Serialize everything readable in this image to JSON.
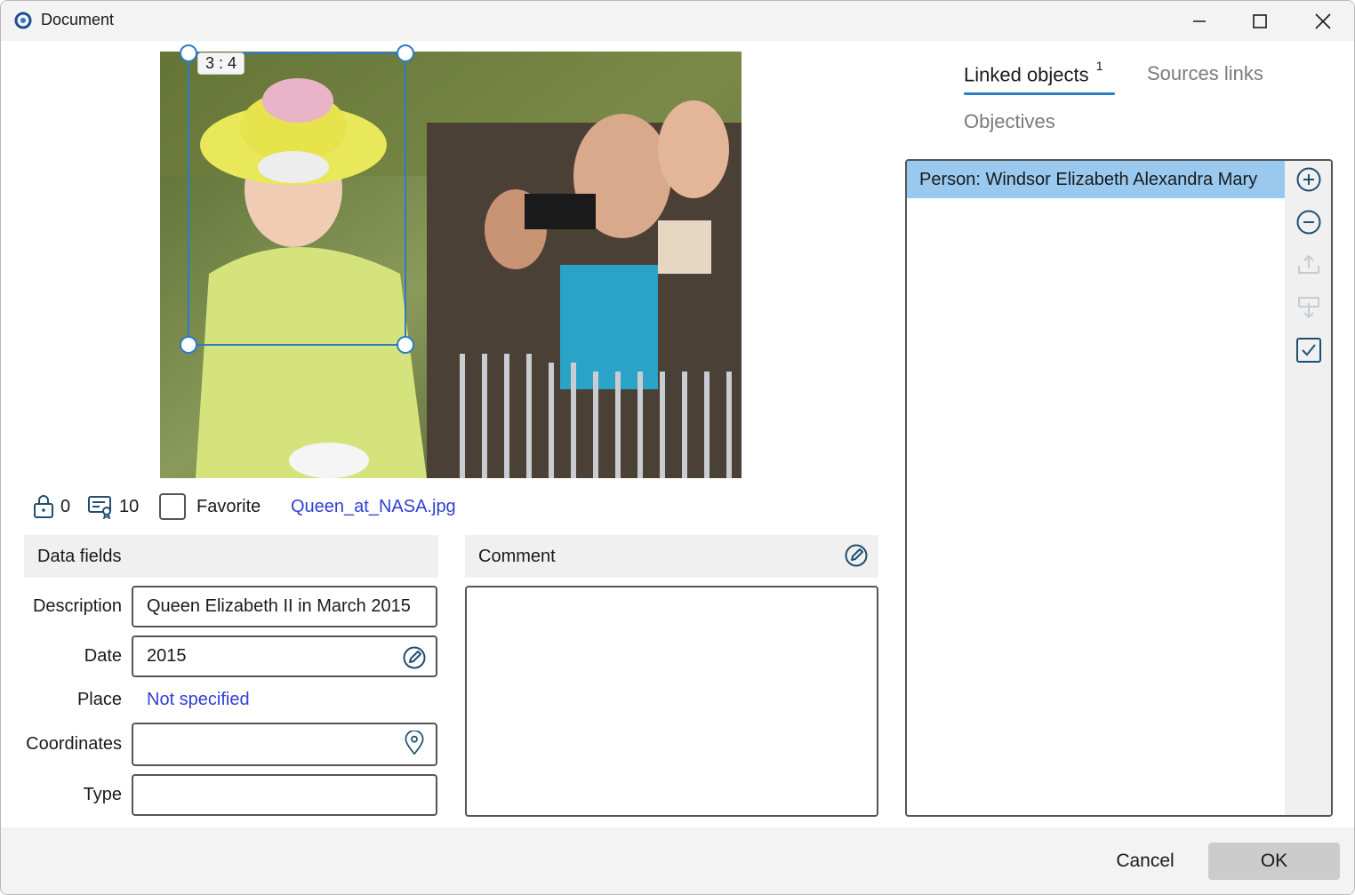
{
  "window": {
    "title": "Document"
  },
  "photo": {
    "crop_ratio": "3 : 4"
  },
  "info": {
    "lock_count": "0",
    "certificate_count": "10",
    "favorite_label": "Favorite",
    "favorite_checked": false,
    "filename": "Queen_at_NASA.jpg"
  },
  "data_fields": {
    "header": "Data fields",
    "description": {
      "label": "Description",
      "value": "Queen Elizabeth II in March 2015"
    },
    "date": {
      "label": "Date",
      "value": "2015"
    },
    "place": {
      "label": "Place",
      "value": "Not specified"
    },
    "coordinates": {
      "label": "Coordinates",
      "value": ""
    },
    "type": {
      "label": "Type",
      "value": ""
    }
  },
  "comment": {
    "header": "Comment",
    "value": ""
  },
  "tabs": {
    "linked_objects": "Linked objects",
    "linked_objects_count": "1",
    "sources_links": "Sources links",
    "objectives": "Objectives"
  },
  "linked_list": {
    "items": [
      "Person: Windsor Elizabeth Alexandra Mary"
    ]
  },
  "footer": {
    "cancel": "Cancel",
    "ok": "OK"
  },
  "colors": {
    "accent": "#2b7cc9",
    "link": "#2f3fd6",
    "selection": "#99c9ef"
  }
}
